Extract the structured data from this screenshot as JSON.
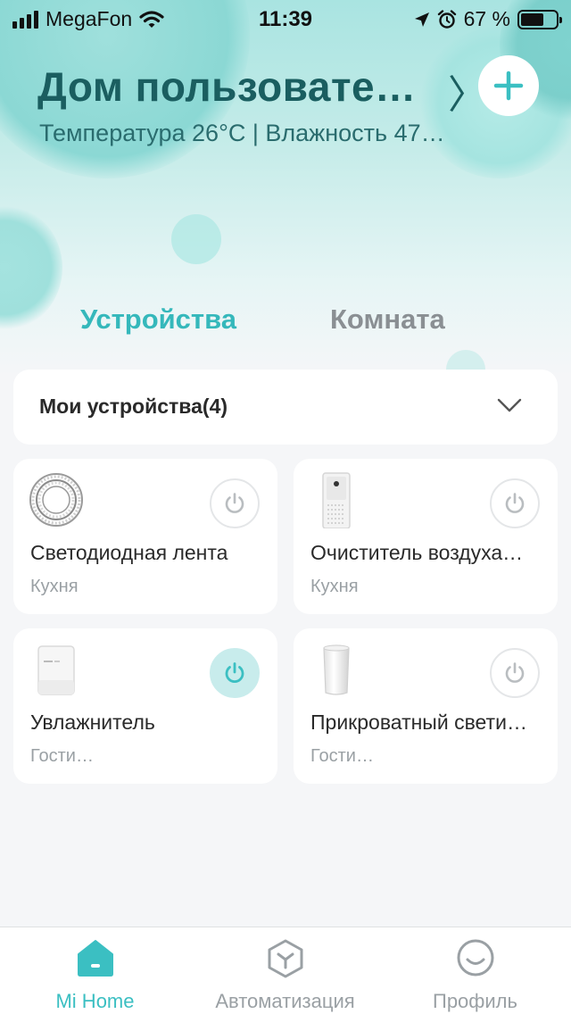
{
  "status_bar": {
    "carrier": "MegaFon",
    "time": "11:39",
    "battery": "67 %",
    "battery_level": 0.67
  },
  "header": {
    "title": "Дом пользовате…",
    "subtitle": "Температура 26°C | Влажность 47…"
  },
  "tabs": [
    {
      "label": "Устройства",
      "active": true
    },
    {
      "label": "Комната",
      "active": false
    }
  ],
  "group": {
    "label": "Мои устройства(4)"
  },
  "devices": [
    {
      "name": "Светодиодная лента",
      "room": "Кухня",
      "icon": "led-strip-icon",
      "on": false
    },
    {
      "name": "Очиститель воздуха…",
      "room": "Кухня",
      "icon": "air-purifier-icon",
      "on": false
    },
    {
      "name": "Увлажнитель",
      "room": "Гости…",
      "icon": "humidifier-icon",
      "on": true
    },
    {
      "name": "Прикроватный свети…",
      "room": "Гости…",
      "icon": "bedside-lamp-icon",
      "on": false
    }
  ],
  "nav": [
    {
      "label": "Mi Home",
      "icon": "home-icon",
      "active": true
    },
    {
      "label": "Автоматизация",
      "icon": "automation-icon",
      "active": false
    },
    {
      "label": "Профиль",
      "icon": "profile-icon",
      "active": false
    }
  ],
  "colors": {
    "accent": "#3bbfc2",
    "title": "#1a5e60",
    "inactive": "#9aa0a4"
  }
}
